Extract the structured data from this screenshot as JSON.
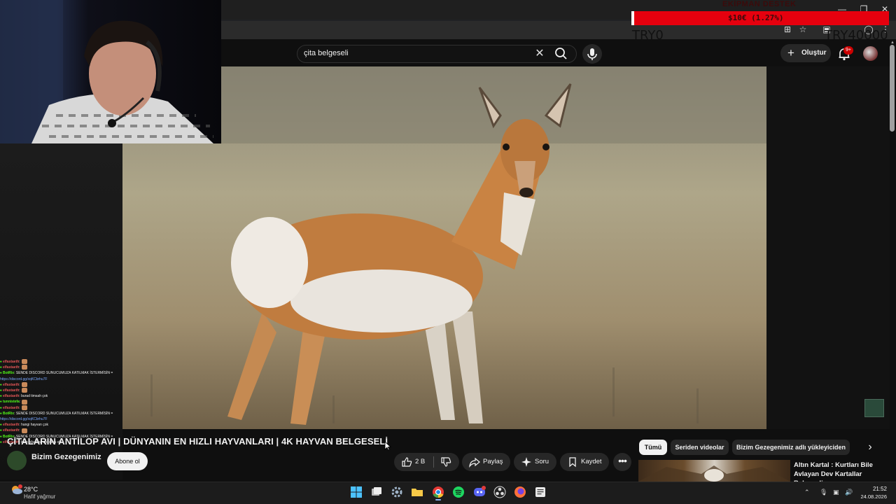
{
  "donation": {
    "title": "EKİPMAN DESTEK",
    "progress": "$10€ (1.27%)",
    "progress_percent": 1.27,
    "current": "TRY0",
    "goal": "TRY40000"
  },
  "search": {
    "query": "çita belgeseli"
  },
  "header": {
    "create_label": "Oluştur",
    "notifications_badge": "9+"
  },
  "video": {
    "title": "ÇİTALARIN ANTİLOP AVI | DÜNYANIN EN HIZLI HAYVANLARI | 4K HAYVAN BELGESELİ",
    "channel_name": "Bizim Gezegenimiz",
    "subscribe_label": "Abone ol",
    "likes": "2 B",
    "share_label": "Paylaş",
    "ask_label": "Soru",
    "save_label": "Kaydet"
  },
  "recommendations": {
    "chips": [
      "Tümü",
      "Seriden videolar",
      "Bizim Gezegenimiz adlı yükleyiciden"
    ],
    "first": {
      "title": "Altın Kartal : Kurtları Bile Avlayan Dev Kartallar Belgeseli"
    }
  },
  "chat": [
    {
      "user": "elfastaeth",
      "text": ":",
      "user_color": "#e05555",
      "emote": true
    },
    {
      "user": "elfastaeth",
      "text": ":",
      "user_color": "#e05555",
      "emote": true
    },
    {
      "user": "BotRix",
      "text": ": SENDE DISCORD SUNUCUMUZA KATILMAK İSTERMİSİN =",
      "user_color": "#53fc18",
      "link": "https://discord.gg/xqKCbrhu7F"
    },
    {
      "user": "elfastaeth",
      "text": ":",
      "user_color": "#e05555",
      "emote": true
    },
    {
      "user": "elfastaeth",
      "text": ":",
      "user_color": "#e05555",
      "emote": true
    },
    {
      "user": "elfastaeth",
      "text": ": burad timsah çok",
      "user_color": "#e05555"
    },
    {
      "user": "tunnistefa",
      "text": ":",
      "user_color": "#53fc18",
      "emote": true
    },
    {
      "user": "elfastaeth",
      "text": ":",
      "user_color": "#e05555",
      "emote": true
    },
    {
      "user": "BotRix",
      "text": ": SENDE DISCORD SUNUCUMUZA KATILMAK İSTERMİSİN =",
      "user_color": "#53fc18",
      "link": "https://discord.gg/xqKCbrhu7F"
    },
    {
      "user": "elfastaeth",
      "text": ": hangi hayvan çok",
      "user_color": "#e05555"
    },
    {
      "user": "elfastaeth",
      "text": ":",
      "user_color": "#e05555",
      "emote": true
    },
    {
      "user": "BotRix",
      "text": ": SENDE DISCORD SUNUCUMUZA KATILMAK İSTERMİSİN =",
      "user_color": "#53fc18"
    },
    {
      "user": "elfastaeth",
      "text": ": kere oğuzhan abi okcu olo",
      "user_color": "#e05555"
    }
  ],
  "taskbar": {
    "temperature": "28°C",
    "weather": "Hafif yağmur",
    "time": "21:52",
    "date": "24.08.2026",
    "apps": [
      "start",
      "task-view",
      "settings",
      "file-explorer",
      "chrome",
      "spotify",
      "discord",
      "obs",
      "firefox",
      "notepad"
    ]
  },
  "colors": {
    "background": "#0f0f0f",
    "donation_bar": "#e6000e",
    "pill": "#272727",
    "text": "#f1f1f1"
  }
}
